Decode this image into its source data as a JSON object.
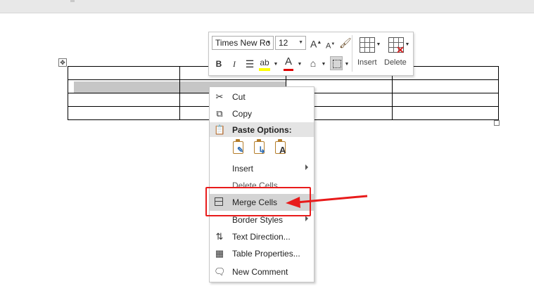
{
  "mini_toolbar": {
    "font_name": "Times New Ro",
    "font_size": "12",
    "grow_label": "A",
    "shrink_label": "A",
    "bold": "B",
    "italic": "I",
    "font_color_label": "A",
    "insert_label": "Insert",
    "delete_label": "Delete",
    "highlight_color": "#ffff00",
    "font_color": "#e00000"
  },
  "context_menu": {
    "items": [
      {
        "label": "Cut",
        "icon": "scissors-icon"
      },
      {
        "label": "Copy",
        "icon": "copy-icon"
      },
      {
        "label": "Paste Options:",
        "icon": "paste-icon"
      },
      {
        "label": "Insert",
        "has_submenu": true
      },
      {
        "label": "Delete Cells...",
        "disabled": true
      },
      {
        "label": "Merge Cells",
        "icon": "merge-cells-icon",
        "highlighted": true
      },
      {
        "label": "Border Styles",
        "has_submenu": true
      },
      {
        "label": "Text Direction...",
        "icon": "text-direction-icon"
      },
      {
        "label": "Table Properties...",
        "icon": "table-properties-icon"
      },
      {
        "label": "New Comment",
        "icon": "new-comment-icon"
      }
    ],
    "paste_options": [
      "keep-source-formatting-icon",
      "merge-formatting-icon",
      "keep-text-only-icon"
    ]
  },
  "table": {
    "rows": 4,
    "columns": 4
  },
  "colors": {
    "annotation": "#e81b1b",
    "menu_hover": "#d4d4d4"
  }
}
